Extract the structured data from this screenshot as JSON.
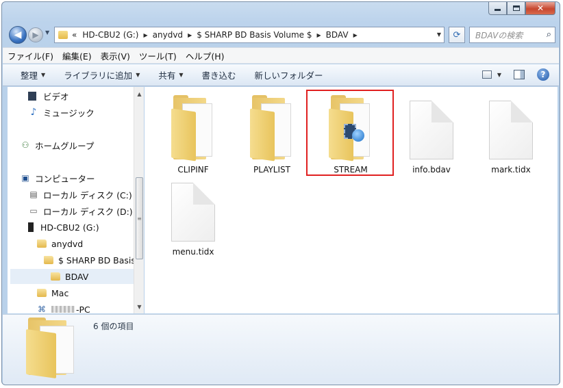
{
  "window": {
    "controls": {
      "minimize": "minimize",
      "maximize": "maximize",
      "close": "✕"
    }
  },
  "nav": {
    "breadcrumb_prefix": "«",
    "breadcrumb": [
      "HD-CBU2 (G:)",
      "anydvd",
      "$ SHARP BD Basis Volume $",
      "BDAV"
    ],
    "search_placeholder": "BDAVの検索"
  },
  "menubar": [
    "ファイル(F)",
    "編集(E)",
    "表示(V)",
    "ツール(T)",
    "ヘルプ(H)"
  ],
  "toolbar": {
    "organize": "整理",
    "add_to_library": "ライブラリに追加",
    "share": "共有",
    "burn": "書き込む",
    "new_folder": "新しいフォルダー"
  },
  "navpane": {
    "items": [
      {
        "label": "ビデオ",
        "icon": "video-icon"
      },
      {
        "label": "ミュージック",
        "icon": "music-icon"
      },
      {
        "label": "ホームグループ",
        "icon": "homegroup-icon"
      },
      {
        "label": "コンピューター",
        "icon": "computer-icon"
      },
      {
        "label": "ローカル ディスク (C:)",
        "icon": "drive-icon"
      },
      {
        "label": "ローカル ディスク (D:)",
        "icon": "drive-icon"
      },
      {
        "label": "HD-CBU2 (G:)",
        "icon": "external-drive-icon"
      },
      {
        "label": "anydvd",
        "icon": "folder-icon"
      },
      {
        "label": "$ SHARP BD Basis Volume $",
        "icon": "folder-icon"
      },
      {
        "label": "BDAV",
        "icon": "folder-icon"
      },
      {
        "label": "Mac",
        "icon": "folder-icon"
      },
      {
        "label": "-PC",
        "icon": "network-pc-icon"
      }
    ],
    "selected": "BDAV"
  },
  "files": [
    {
      "name": "CLIPINF",
      "type": "folder"
    },
    {
      "name": "PLAYLIST",
      "type": "folder"
    },
    {
      "name": "STREAM",
      "type": "media-folder",
      "highlighted": true
    },
    {
      "name": "info.bdav",
      "type": "file"
    },
    {
      "name": "mark.tidx",
      "type": "file"
    },
    {
      "name": "menu.tidx",
      "type": "file"
    }
  ],
  "details": {
    "count_text": "6 個の項目"
  },
  "colors": {
    "highlight": "#e02020",
    "selection": "#e5eef8",
    "chrome": "#bcd3ec"
  }
}
